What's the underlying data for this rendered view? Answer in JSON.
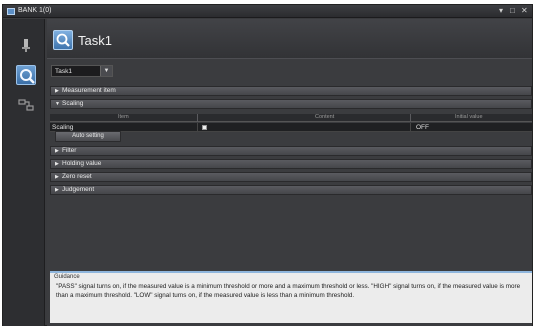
{
  "window": {
    "title": "BANK 1(0)",
    "controls": [
      "▾",
      "□",
      "✕"
    ]
  },
  "leftbar": {
    "icons": [
      "sensor-icon",
      "search-settings-icon",
      "flow-icon"
    ]
  },
  "task": {
    "title": "Task1",
    "selector_value": "Task1"
  },
  "sections": {
    "measurement_item": "Measurement item",
    "scaling": "Scaling",
    "filter": "Filter",
    "holding_value": "Holding value",
    "zero_reset": "Zero reset",
    "judgement": "Judgement"
  },
  "scaling_table": {
    "headers": [
      "Item",
      "Content",
      "Initial value"
    ],
    "row": {
      "item": "Scaling",
      "content_checked": true,
      "initial_value": "OFF"
    }
  },
  "auto_setting_label": "Auto setting",
  "guidance": {
    "title": "Guidance",
    "text": "\"PASS\" signal turns on, if the measured value is a minimum threshold or more and a maximum threshold or less. \"HIGH\" signal turns on, if the measured value is more than a maximum threshold. \"LOW\" signal turns on, if the measured value is less than a minimum threshold."
  }
}
